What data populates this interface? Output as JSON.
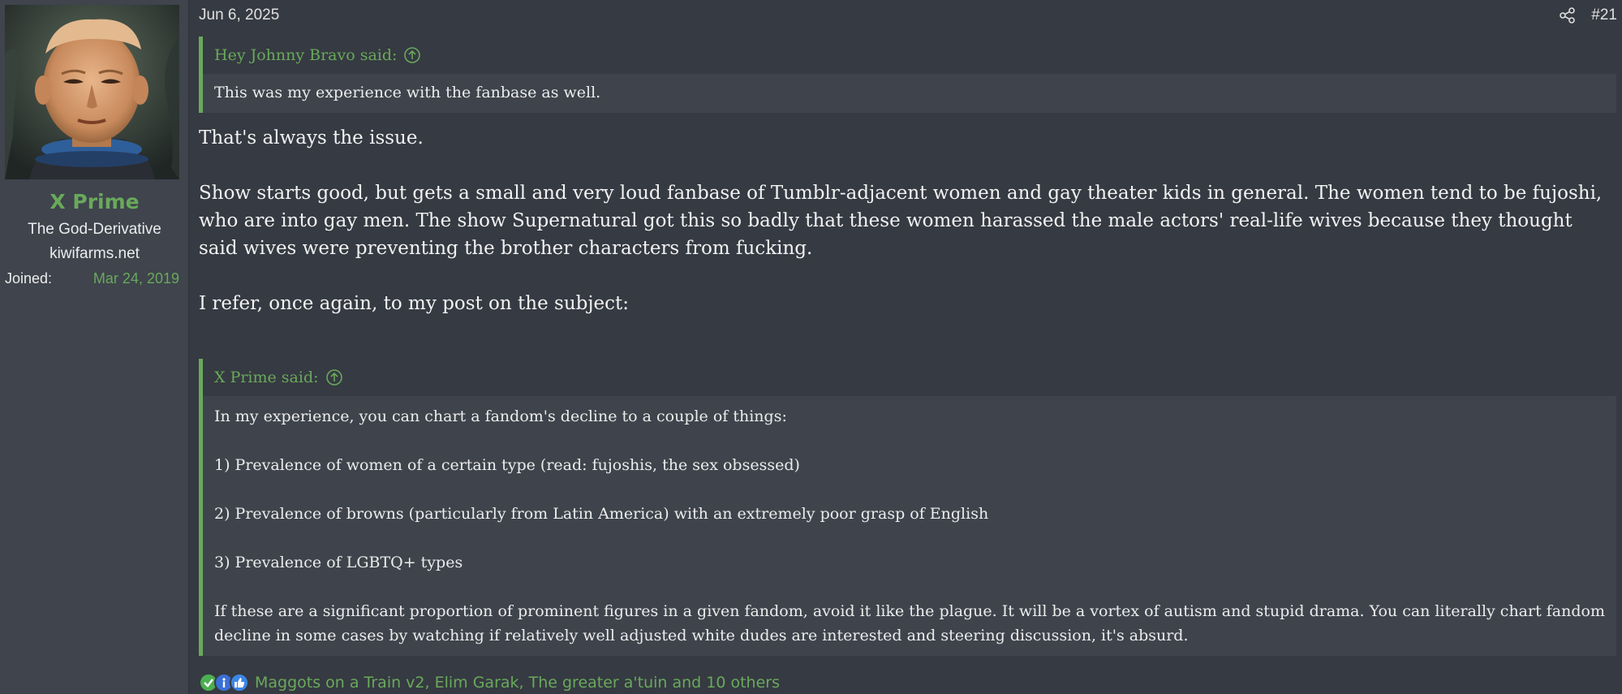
{
  "user": {
    "name": "X Prime",
    "title": "The God-Derivative",
    "site": "kiwifarms.net",
    "joined_label": "Joined:",
    "joined_date": "Mar 24, 2019"
  },
  "post": {
    "date": "Jun 6, 2025",
    "number": "#21",
    "share_icon": "share-icon",
    "quote1": {
      "author": "Hey Johnny Bravo said:",
      "text": "This was my experience with the fanbase as well."
    },
    "paragraphs": [
      "That's always the issue.",
      "Show starts good, but gets a small and very loud fanbase of Tumblr-adjacent women and gay theater kids in general. The women tend to be fujoshi, who are into gay men. The show Supernatural got this so badly that these women harassed the male actors' real-life wives because they thought said wives were preventing the brother characters from fucking.",
      "I refer, once again, to my post on the subject:"
    ],
    "quote2": {
      "author": "X Prime said:",
      "lines": [
        "In my experience, you can chart a fandom's decline to a couple of things:",
        "1) Prevalence of women of a certain type (read: fujoshis, the sex obsessed)",
        "2) Prevalence of browns (particularly from Latin America) with an extremely poor grasp of English",
        "3) Prevalence of LGBTQ+ types",
        "If these are a significant proportion of prominent figures in a given fandom, avoid it like the plague. It will be a vortex of autism and stupid drama. You can literally chart fandom decline in some cases by watching if relatively well adjusted white dudes are interested and steering discussion, it's absurd."
      ]
    },
    "reactions": {
      "icons": [
        "check-reaction-icon",
        "informative-reaction-icon",
        "thumbs-up-reaction-icon"
      ],
      "users": "Maggots on a Train v2, Elim Garak, The greater a'tuin and 10 others"
    }
  },
  "colors": {
    "accent": "#69a95b",
    "background": "#363a42",
    "sidebar": "#3f444d",
    "quote_body": "#3f444c"
  }
}
